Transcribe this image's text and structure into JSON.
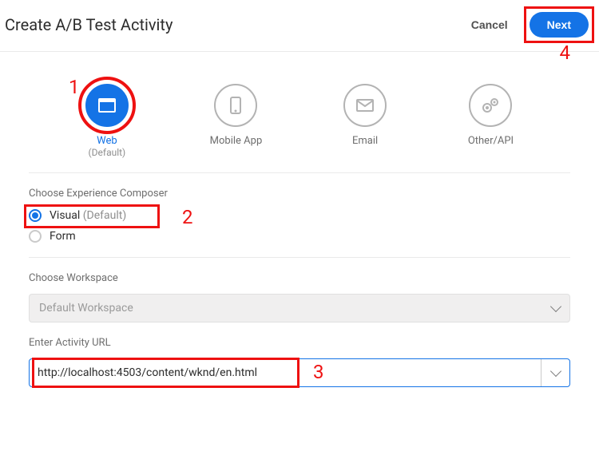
{
  "header": {
    "title": "Create A/B Test Activity",
    "cancel_label": "Cancel",
    "next_label": "Next"
  },
  "annotations": {
    "a1": "1",
    "a2": "2",
    "a3": "3",
    "a4": "4"
  },
  "channels": [
    {
      "label": "Web",
      "sub": "(Default)",
      "selected": true
    },
    {
      "label": "Mobile App",
      "sub": "",
      "selected": false
    },
    {
      "label": "Email",
      "sub": "",
      "selected": false
    },
    {
      "label": "Other/API",
      "sub": "",
      "selected": false
    }
  ],
  "composer": {
    "section_label": "Choose Experience Composer",
    "visual_label": "Visual",
    "visual_default": " (Default)",
    "form_label": "Form"
  },
  "workspace": {
    "section_label": "Choose Workspace",
    "value": "Default Workspace"
  },
  "url": {
    "section_label": "Enter Activity URL",
    "value": "http://localhost:4503/content/wknd/en.html"
  }
}
